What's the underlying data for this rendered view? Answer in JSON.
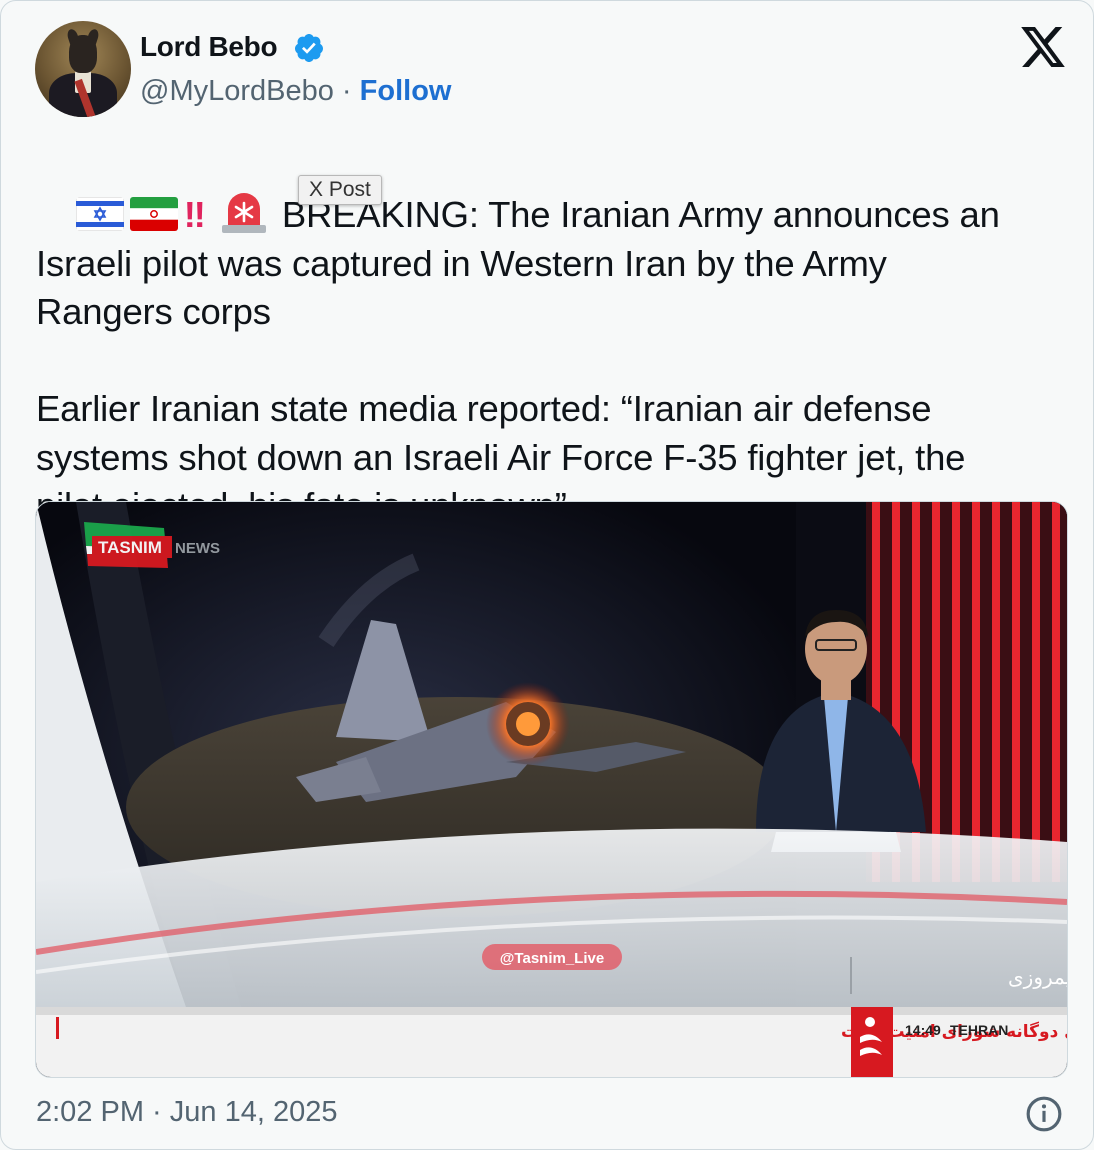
{
  "author": {
    "name": "Lord Bebo",
    "handle": "@MyLordBebo",
    "separator": " · ",
    "follow_label": "Follow",
    "verified": true
  },
  "tweet": {
    "emoji": [
      "israel-flag-icon",
      "iran-flag-icon",
      "double-exclamation-icon",
      "siren-icon"
    ],
    "text_line1": "BREAKING: The Iranian Army announces an",
    "text_rest": "Israeli pilot was captured in Western Iran by the Army\nRangers corps\n\nEarlier Iranian state media reported: “Iranian air defense\nsystems shot down an Israeli Air Force F-35 fighter jet, the\npilot ejected, his fate is unknown”",
    "tooltip": "X Post"
  },
  "media": {
    "logo_main": "TASNIM",
    "logo_sub": "NEWS",
    "watermark": "@Tasnim_Live",
    "program_title": "خبر نیمروزی",
    "ticker_text": "سازمان ملل: تجاوز رژیم صهیونیستی، نتیجه بی‌عملی و معیارهای دوگانه شورای امنیت است",
    "clock_time": "14:49",
    "clock_city": "TEHRAN"
  },
  "footer": {
    "timestamp": "2:02 PM · Jun 14, 2025"
  },
  "colors": {
    "follow": "#1d6fd1",
    "verified": "#1d9bf0",
    "muted": "#536471",
    "ticker_red": "#d71920"
  }
}
